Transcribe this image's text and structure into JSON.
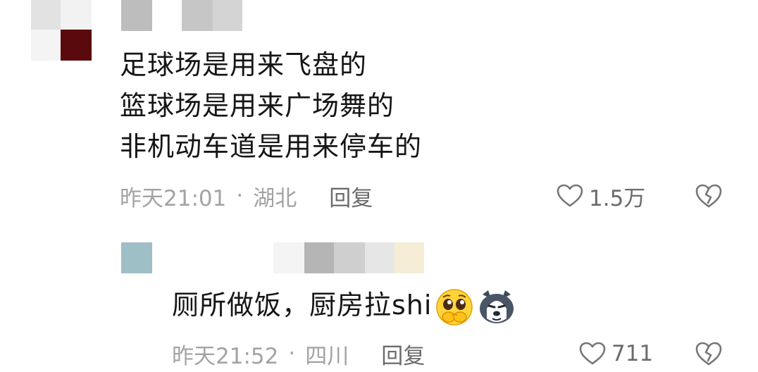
{
  "comments": [
    {
      "lines": [
        "足球场是用来飞盘的",
        "篮球场是用来广场舞的",
        "非机动车道是用来停车的"
      ],
      "time": "昨天21:01",
      "location": "湖北",
      "reply_label": "回复",
      "likes": "1.5万"
    },
    {
      "text": "厕所做饭，厨房拉shi",
      "emojis": [
        "pleading-face-emoji",
        "husky-dog-emoji"
      ],
      "time": "昨天21:52",
      "location": "四川",
      "reply_label": "回复",
      "likes": "711"
    }
  ],
  "separator": "·",
  "colors": {
    "text": "#161616",
    "meta": "#a3a3a3",
    "action": "#6b6b6b"
  }
}
